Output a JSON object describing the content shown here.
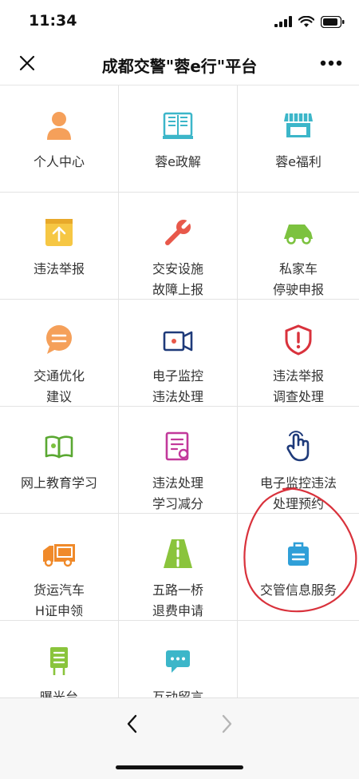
{
  "status_bar": {
    "time": "11:34"
  },
  "nav": {
    "title": "成都交警\"蓉e行\"平台"
  },
  "grid": {
    "items": [
      {
        "line1": "个人中心",
        "line2": "",
        "icon": "person-icon"
      },
      {
        "line1": "蓉e政解",
        "line2": "",
        "icon": "open-book-icon"
      },
      {
        "line1": "蓉e福利",
        "line2": "",
        "icon": "shop-icon"
      },
      {
        "line1": "违法举报",
        "line2": "",
        "icon": "upload-box-icon"
      },
      {
        "line1": "交安设施",
        "line2": "故障上报",
        "icon": "wrench-icon"
      },
      {
        "line1": "私家车",
        "line2": "停驶申报",
        "icon": "car-icon"
      },
      {
        "line1": "交通优化",
        "line2": "建议",
        "icon": "chat-bubble-icon"
      },
      {
        "line1": "电子监控",
        "line2": "违法处理",
        "icon": "camera-icon"
      },
      {
        "line1": "违法举报",
        "line2": "调查处理",
        "icon": "shield-alert-icon"
      },
      {
        "line1": "网上教育学习",
        "line2": "",
        "icon": "reading-book-icon"
      },
      {
        "line1": "违法处理",
        "line2": "学习减分",
        "icon": "certificate-icon"
      },
      {
        "line1": "电子监控违法",
        "line2": "处理预约",
        "icon": "hand-pointer-icon"
      },
      {
        "line1": "货运汽车",
        "line2": "H证申领",
        "icon": "truck-icon"
      },
      {
        "line1": "五路一桥",
        "line2": "退费申请",
        "icon": "road-icon"
      },
      {
        "line1": "交管信息服务",
        "line2": "",
        "icon": "briefcase-icon"
      },
      {
        "line1": "曝光台",
        "line2": "",
        "icon": "billboard-icon"
      },
      {
        "line1": "互动留言",
        "line2": "",
        "icon": "message-icon"
      },
      {
        "line1": "",
        "line2": "",
        "icon": ""
      }
    ]
  },
  "colors": {
    "orange": "#f5a05a",
    "teal": "#3cb6c9",
    "yellow": "#f6c744",
    "red": "#e8584a",
    "green": "#7cc23f",
    "navy": "#1e3a7a",
    "annotation": "#d9323c"
  }
}
